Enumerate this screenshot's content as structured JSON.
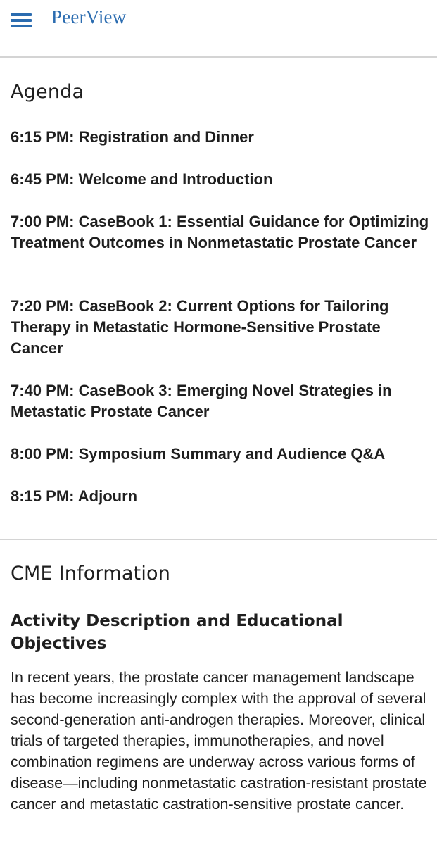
{
  "header": {
    "brand": "PeerView",
    "menu_icon": "hamburger-menu-icon",
    "accent_color": "#2b6cb0"
  },
  "agenda": {
    "title": "Agenda",
    "items": [
      "6:15 PM: Registration and Dinner",
      "6:45 PM: Welcome and Introduction",
      "7:00 PM: CaseBook 1: Essential Guidance for Optimizing Treatment Outcomes in Nonmetastatic Prostate Cancer",
      "7:20 PM: CaseBook 2: Current Options for Tailoring Therapy in Metastatic Hormone-Sensitive Prostate Cancer",
      "7:40 PM: CaseBook 3: Emerging Novel Strategies in Metastatic Prostate Cancer",
      "8:00 PM: Symposium Summary and Audience Q&A",
      "8:15 PM: Adjourn"
    ]
  },
  "cme": {
    "title": "CME Information",
    "subtitle": "Activity Description and Educational Objectives",
    "description": "In recent years, the prostate cancer management landscape has become increasingly complex with the approval of several second-generation anti-androgen therapies. Moreover, clinical trials of targeted therapies, immunotherapies, and novel combination regimens are underway across various forms of disease—including nonmetastatic castration-resistant prostate cancer and metastatic castration-sensitive prostate cancer."
  }
}
